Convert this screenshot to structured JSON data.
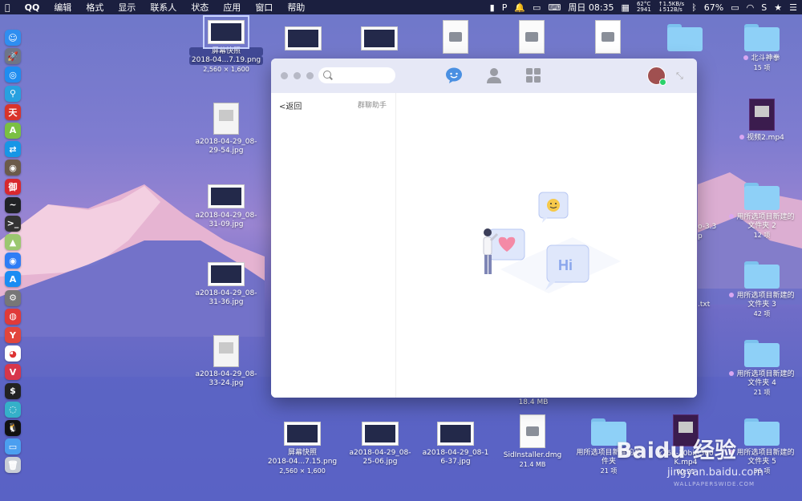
{
  "menubar": {
    "app": "QQ",
    "items": [
      "编辑",
      "格式",
      "显示",
      "联系人",
      "状态",
      "应用",
      "窗口",
      "帮助"
    ],
    "status": {
      "clock": "周日 08:35",
      "temp": "62°C",
      "fan": "2941",
      "net_up": "↑1.5KB/s",
      "net_down": "↓512B/s",
      "battery": "67%"
    }
  },
  "desktop": {
    "column1": [
      {
        "name": "屏幕快照",
        "name2": "2018-04...7.19.png",
        "sub": "2,560 × 1,600",
        "selected": true
      },
      {
        "name": "a2018-04-29_08-",
        "name2": "29-54.jpg"
      },
      {
        "name": "a2018-04-29_08-",
        "name2": "31-09.jpg"
      },
      {
        "name": "a2018-04-29_08-",
        "name2": "31-36.jpg"
      },
      {
        "name": "a2018-04-29_08-",
        "name2": "33-24.jpg"
      }
    ],
    "right": [
      {
        "name": "北斗神拳",
        "sub": "15 项"
      },
      {
        "name": "视频2.mp4"
      },
      {
        "name": "用所选项目新建的",
        "name2": "文件夹 2",
        "sub": "12 项"
      },
      {
        "name": "用所选项目新建的",
        "name2": "文件夹 3",
        "sub": "42 项"
      },
      {
        "name": "用所选项目新建的",
        "name2": "文件夹 4",
        "sub": "21 项"
      },
      {
        "name": "用所选项目新建的",
        "name2": "文件夹 5",
        "sub": "56 项"
      }
    ],
    "partial": [
      "4",
      "o-3.3",
      "p",
      ".txt"
    ],
    "size_label": "18.4 MB",
    "bottom": [
      {
        "name": "屏幕快照",
        "name2": "2018-04...7.15.png",
        "sub": "2,560 × 1,600"
      },
      {
        "name": "a2018-04-29_08-",
        "name2": "25-06.jpg"
      },
      {
        "name": "a2018-04-29_08-1",
        "name2": "6-37.jpg"
      },
      {
        "name": "SidInstaller.dmg",
        "sub": "21.4 MB"
      },
      {
        "name": "用所选项目新建的文",
        "name2": "件夹",
        "sub": "21 项"
      },
      {
        "name": "x264-10bit-560",
        "name2": "K.mp4",
        "sub": "00:21"
      }
    ]
  },
  "qq": {
    "search_placeholder": "",
    "back_label": "返回",
    "helper_label": "群聊助手",
    "illustration_text": "Hi"
  },
  "watermark": {
    "brand": "Baidu 经验",
    "url": "jingyan.baidu.com",
    "credit": "WALLPAPERSWIDE.COM"
  },
  "colors": {
    "accent": "#4a90e2",
    "menubar": "#1b1f3f",
    "titlebar": "#e6e8f6",
    "folder": "#8ed0f7"
  }
}
